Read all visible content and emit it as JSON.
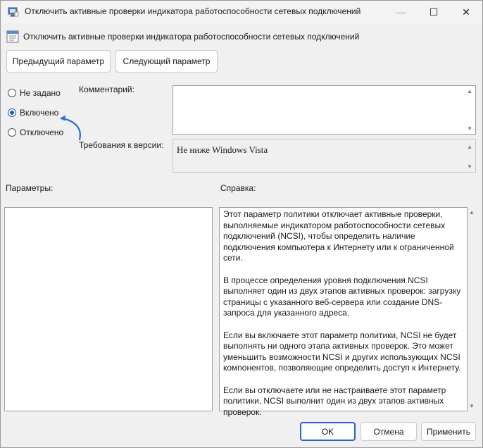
{
  "window": {
    "title": "Отключить активные проверки индикатора работоспособности сетевых подключений",
    "controls": {
      "minimize": "—",
      "maximize": "☐",
      "close": "✕"
    }
  },
  "header": {
    "policy_name": "Отключить активные проверки индикатора работоспособности сетевых подключений"
  },
  "nav": {
    "prev_label": "Предыдущий параметр",
    "next_label": "Следующий параметр"
  },
  "state": {
    "options": [
      {
        "label": "Не задано",
        "checked": false
      },
      {
        "label": "Включено",
        "checked": true
      },
      {
        "label": "Отключено",
        "checked": false
      }
    ]
  },
  "comment": {
    "label": "Комментарий:",
    "value": ""
  },
  "requirements": {
    "label": "Требования к версии:",
    "value": "Не ниже Windows Vista"
  },
  "params": {
    "label": "Параметры:"
  },
  "help": {
    "label": "Справка:",
    "paragraphs": [
      "Этот параметр политики отключает активные проверки, выполняемые индикатором работоспособности сетевых подключений (NCSI), чтобы определить наличие подключения компьютера к Интернету или к ограниченной сети.",
      "В процессе определения уровня подключения NCSI выполняет один из двух этапов активных проверок: загрузку страницы с указанного веб-сервера или создание DNS-запроса для указанного адреса.",
      "Если вы включаете этот параметр политики, NCSI не будет выполнять ни одного этапа активных проверок. Это может уменьшить возможности NCSI и других использующих NCSI компонентов, позволяющие определить доступ к Интернету.",
      "Если вы отключаете или не настраиваете этот параметр политики, NCSI выполнит один из двух этапов активных проверок."
    ]
  },
  "footer": {
    "ok_label": "OK",
    "cancel_label": "Отмена",
    "apply_label": "Применить"
  },
  "colors": {
    "accent": "#1e5bc6",
    "annotation_arrow": "#2a6fd6"
  }
}
